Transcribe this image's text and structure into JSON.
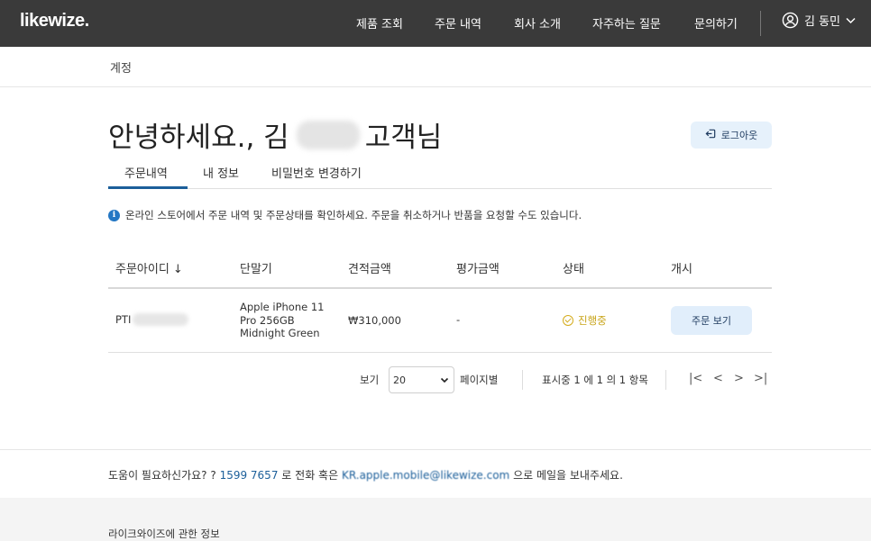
{
  "header": {
    "logo": "likewize.",
    "nav": [
      "제품 조회",
      "주문 내역",
      "회사 소개",
      "자주하는 질문",
      "문의하기"
    ],
    "user_name": "김 동민"
  },
  "breadcrumb": "계정",
  "greeting": {
    "prefix": "안녕하세요., 김",
    "suffix": "고객님"
  },
  "logout_label": "로그아웃",
  "tabs": [
    "주문내역",
    "내 정보",
    "비밀번호 변경하기"
  ],
  "info_text": "온라인 스토어에서 주문 내역 및 주문상태를 확인하세요. 주문을 취소하거나 반품을 요청할 수도 있습니다.",
  "table": {
    "headers": [
      "주문아이디 ↓",
      "단말기",
      "견적금액",
      "평가금액",
      "상태",
      "개시"
    ],
    "rows": [
      {
        "order_id_prefix": "PTI",
        "device": "Apple iPhone 11 Pro 256GB Midnight Green",
        "quote": "₩310,000",
        "evaluated": "-",
        "status": "진행중",
        "action": "주문 보기"
      }
    ]
  },
  "pagination": {
    "view_label": "보기",
    "page_size": "20",
    "per_page_label": "페이지별",
    "summary": "표시중 1 에 1 의 1 항목",
    "first": "|<",
    "prev": "<",
    "next": ">",
    "last": ">|"
  },
  "help": {
    "prefix": "도움이 필요하신가요? ?",
    "phone": "1599 7657",
    "mid": "로 전화 혹은",
    "email": "KR.apple.mobile@likewize.com",
    "suffix": "으로 메일을 보내주세요."
  },
  "footer": {
    "title": "라이크와이즈에 관한 정보"
  },
  "colors": {
    "nav_bg": "#3a3a3a",
    "accent": "#1c5f9a",
    "status": "#c8a418",
    "button_bg": "#e1eefb"
  }
}
